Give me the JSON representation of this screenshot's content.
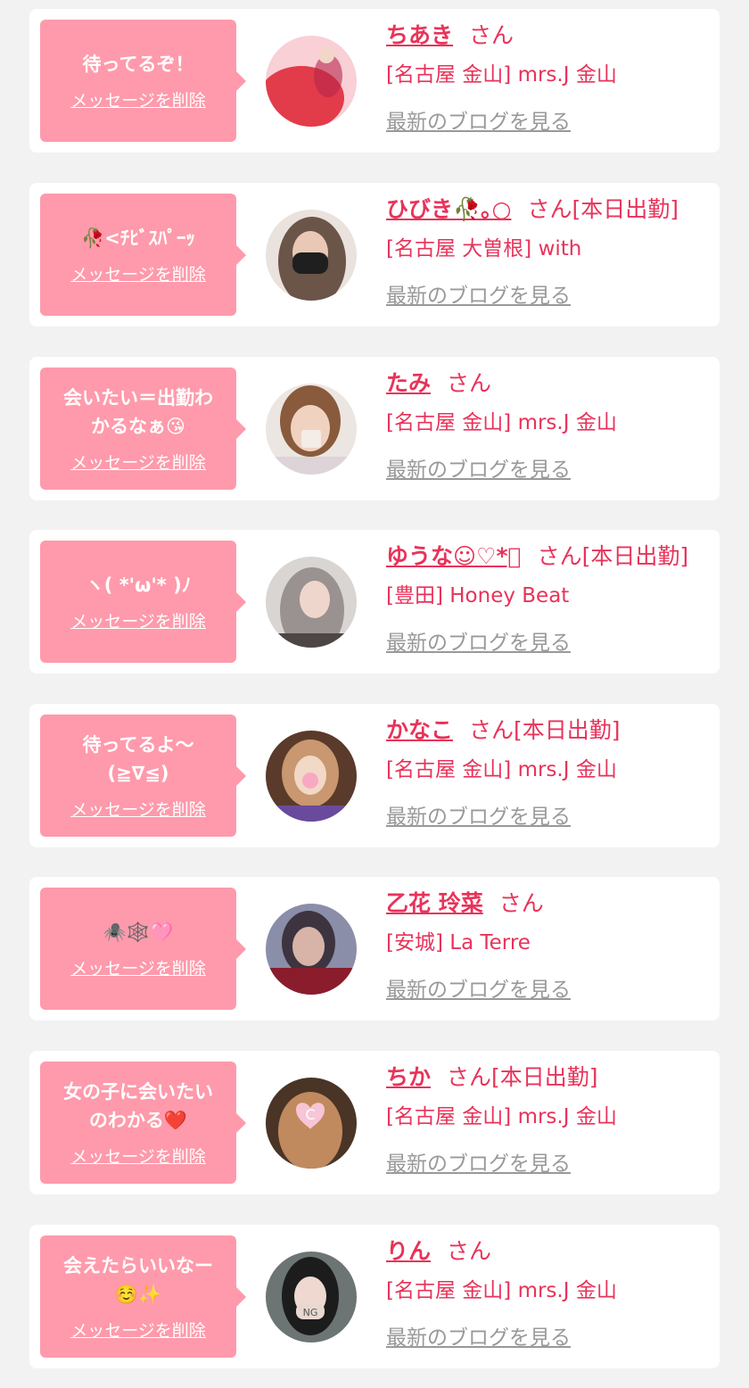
{
  "cards": [
    {
      "message": "待ってるぞ！",
      "delete_label": "メッセージを削除",
      "name": "ちあき",
      "suffix": "さん",
      "shop": "[名古屋 金山] mrs.J 金山",
      "blog_label": "最新のブログを見る",
      "avatar_colors": [
        "#f8d0d6",
        "#e23b4a",
        "#b8264a"
      ]
    },
    {
      "message": "🥀<ﾁﾋﾞｽﾊﾟｰｯ",
      "delete_label": "メッセージを削除",
      "name": "ひびき🥀｡○",
      "suffix": "さん[本日出勤]",
      "shop": "[名古屋 大曽根] with",
      "blog_label": "最新のブログを見る",
      "avatar_colors": [
        "#e9e2dd",
        "#6b5448",
        "#1f1f1f"
      ]
    },
    {
      "message": "会いたい＝出勤わ\nかるなぁ😘",
      "delete_label": "メッセージを削除",
      "name": "たみ",
      "suffix": "さん",
      "shop": "[名古屋 金山] mrs.J 金山",
      "blog_label": "最新のブログを見る",
      "avatar_colors": [
        "#ece6e2",
        "#8a5a3c",
        "#f4ece6"
      ]
    },
    {
      "message": "ヽ( *'ω'* )ﾉ",
      "delete_label": "メッセージを削除",
      "name": "ゆうな☺︎♡*ﾟ",
      "suffix": "さん[本日出勤]",
      "shop": "[豊田] Honey Beat",
      "blog_label": "最新のブログを見る",
      "avatar_colors": [
        "#d9d5d3",
        "#9a9291",
        "#4d4645"
      ]
    },
    {
      "message": "待ってるよ〜\n(≧∇≦)",
      "delete_label": "メッセージを削除",
      "name": "かなこ",
      "suffix": "さん[本日出勤]",
      "shop": "[名古屋 金山] mrs.J 金山",
      "blog_label": "最新のブログを見る",
      "avatar_colors": [
        "#5a3a2a",
        "#c99770",
        "#6a4a9c"
      ]
    },
    {
      "message": "🕷️🕸️🩷",
      "delete_label": "メッセージを削除",
      "name": "乙花 玲菜",
      "suffix": "さん",
      "shop": "[安城] La Terre",
      "blog_label": "最新のブログを見る",
      "avatar_colors": [
        "#8a8ea8",
        "#d8b4a8",
        "#8a1c2c"
      ]
    },
    {
      "message": "女の子に会いたい\nのわかる❤️",
      "delete_label": "メッセージを削除",
      "name": "ちか",
      "suffix": "さん[本日出勤]",
      "shop": "[名古屋 金山] mrs.J 金山",
      "blog_label": "最新のブログを見る",
      "avatar_colors": [
        "#4a3426",
        "#c08a5e",
        "#f6c6d6"
      ]
    },
    {
      "message": "会えたらいいなー\n☺️✨",
      "delete_label": "メッセージを削除",
      "name": "りん",
      "suffix": "さん",
      "shop": "[名古屋 金山] mrs.J 金山",
      "blog_label": "最新のブログを見る",
      "avatar_colors": [
        "#6c7474",
        "#1c1c1c",
        "#e8d8d0"
      ],
      "mask_text": "NG"
    }
  ]
}
